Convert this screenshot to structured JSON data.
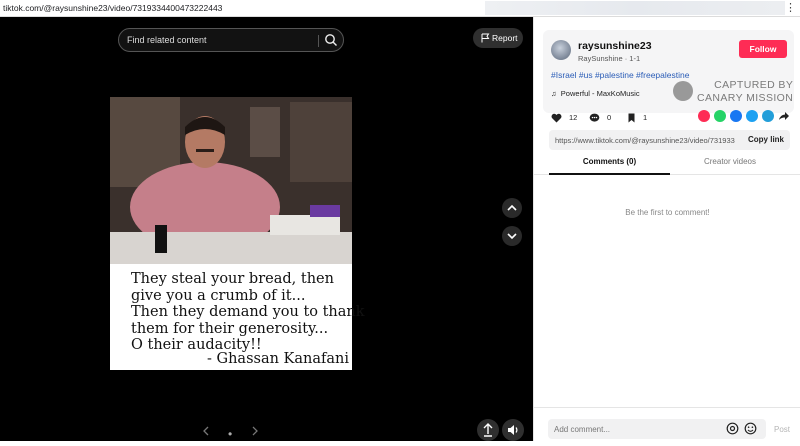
{
  "browser": {
    "url": "tiktok.com/@raysunshine23/video/7319334400473222443"
  },
  "video": {
    "search_placeholder": "Find related content",
    "report_label": "Report",
    "quote_lines": "They steal your bread, then\ngive you a crumb of it...\nThen they demand you to thank\nthem for their generosity...\nO their audacity!!",
    "quote_author": "- Ghassan Kanafani",
    "pager_dot": "•"
  },
  "author": {
    "username": "raysunshine23",
    "subline": "RaySunshine · 1-1",
    "follow_label": "Follow",
    "hashtags": "#Israel #us #palestine #freepalestine",
    "music": "Powerful - MaxKoMusic"
  },
  "watermark": {
    "line1": "CAPTURED BY",
    "line2": "CANARY MISSION"
  },
  "stats": {
    "likes": "12",
    "comments": "0",
    "bookmarks": "1"
  },
  "share": {
    "link": "https://www.tiktok.com/@raysunshine23/video/731933...",
    "copy_label": "Copy link",
    "colors": [
      "#fe2c55",
      "#25d366",
      "#1877f2",
      "#1da1f2",
      "#229ed9"
    ]
  },
  "tabs": [
    {
      "label": "Comments (0)"
    },
    {
      "label": "Creator videos"
    }
  ],
  "comments": {
    "empty_text": "Be the first to comment!",
    "placeholder": "Add comment...",
    "post_label": "Post"
  }
}
